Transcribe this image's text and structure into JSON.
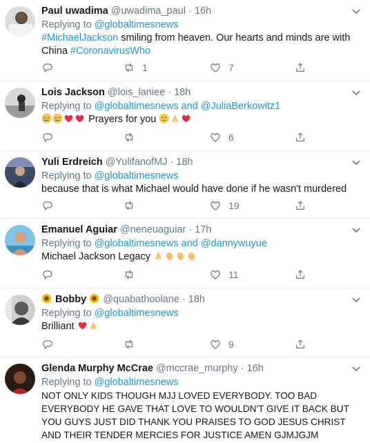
{
  "tweets": [
    {
      "name": "Paul uwadima",
      "handle": "@uwadima_paul",
      "time": "16h",
      "replying_label": "Replying to",
      "replying_to": "@globaltimesnews",
      "text_parts": [
        "#MichaelJackson",
        " smiling from heaven. Our hearts and minds are with China ",
        "#CoronavirusWho"
      ],
      "reply_count": "",
      "retweet_count": "1",
      "like_count": "7"
    },
    {
      "name": "Lois Jackson",
      "handle": "@lois_laniee",
      "time": "18h",
      "replying_label": "Replying to",
      "replying_to": "@globaltimesnews and @JuliaBerkowitz1",
      "text": "Prayers for you",
      "reply_count": "",
      "retweet_count": "",
      "like_count": "6"
    },
    {
      "name": "Yuli Erdreich",
      "handle": "@YulifanofMJ",
      "time": "18h",
      "replying_label": "Replying to",
      "replying_to": "@globaltimesnews",
      "text": "because that is what Michael would have done if he wasn't murdered",
      "reply_count": "",
      "retweet_count": "",
      "like_count": "19"
    },
    {
      "name": "Emanuel Aguiar",
      "handle": "@neneuaguiar",
      "time": "17h",
      "replying_label": "Replying to",
      "replying_to": "@globaltimesnews and @dannywuyue",
      "text": "Michael Jackson Legacy",
      "reply_count": "",
      "retweet_count": "",
      "like_count": "11"
    },
    {
      "name": "Bobby",
      "handle": "@quabathoolane",
      "time": "18h",
      "replying_label": "Replying to",
      "replying_to": "@globaltimesnews",
      "text": "Brilliant",
      "reply_count": "",
      "retweet_count": "",
      "like_count": "9"
    },
    {
      "name": "Glenda Murphy McCrae",
      "handle": "@mccrae_murphy",
      "time": "16h",
      "replying_label": "Replying to",
      "replying_to": "@globaltimesnews",
      "text_lines": [
        "NOT ONLY KIDS THOUGH MJJ LOVED EVERYBODY. TOO BAD",
        "EVERYBODY HE GAVE THAT LOVE TO WOULDN'T GIVE IT BACK BUT",
        "YOU GUYS JUST DID THANK YOU PRAISES TO GOD JESUS CHRIST",
        "AND THEIR TENDER MERCIES FOR JUSTICE AMEN GJMJGJM"
      ]
    }
  ],
  "dot": "·",
  "colors": {
    "link": "#1b95e0",
    "muted": "#657786",
    "text": "#14171a",
    "border": "#e6ecf0"
  },
  "icons": [
    "chevron-down-icon",
    "reply-icon",
    "retweet-icon",
    "like-icon",
    "share-icon"
  ]
}
